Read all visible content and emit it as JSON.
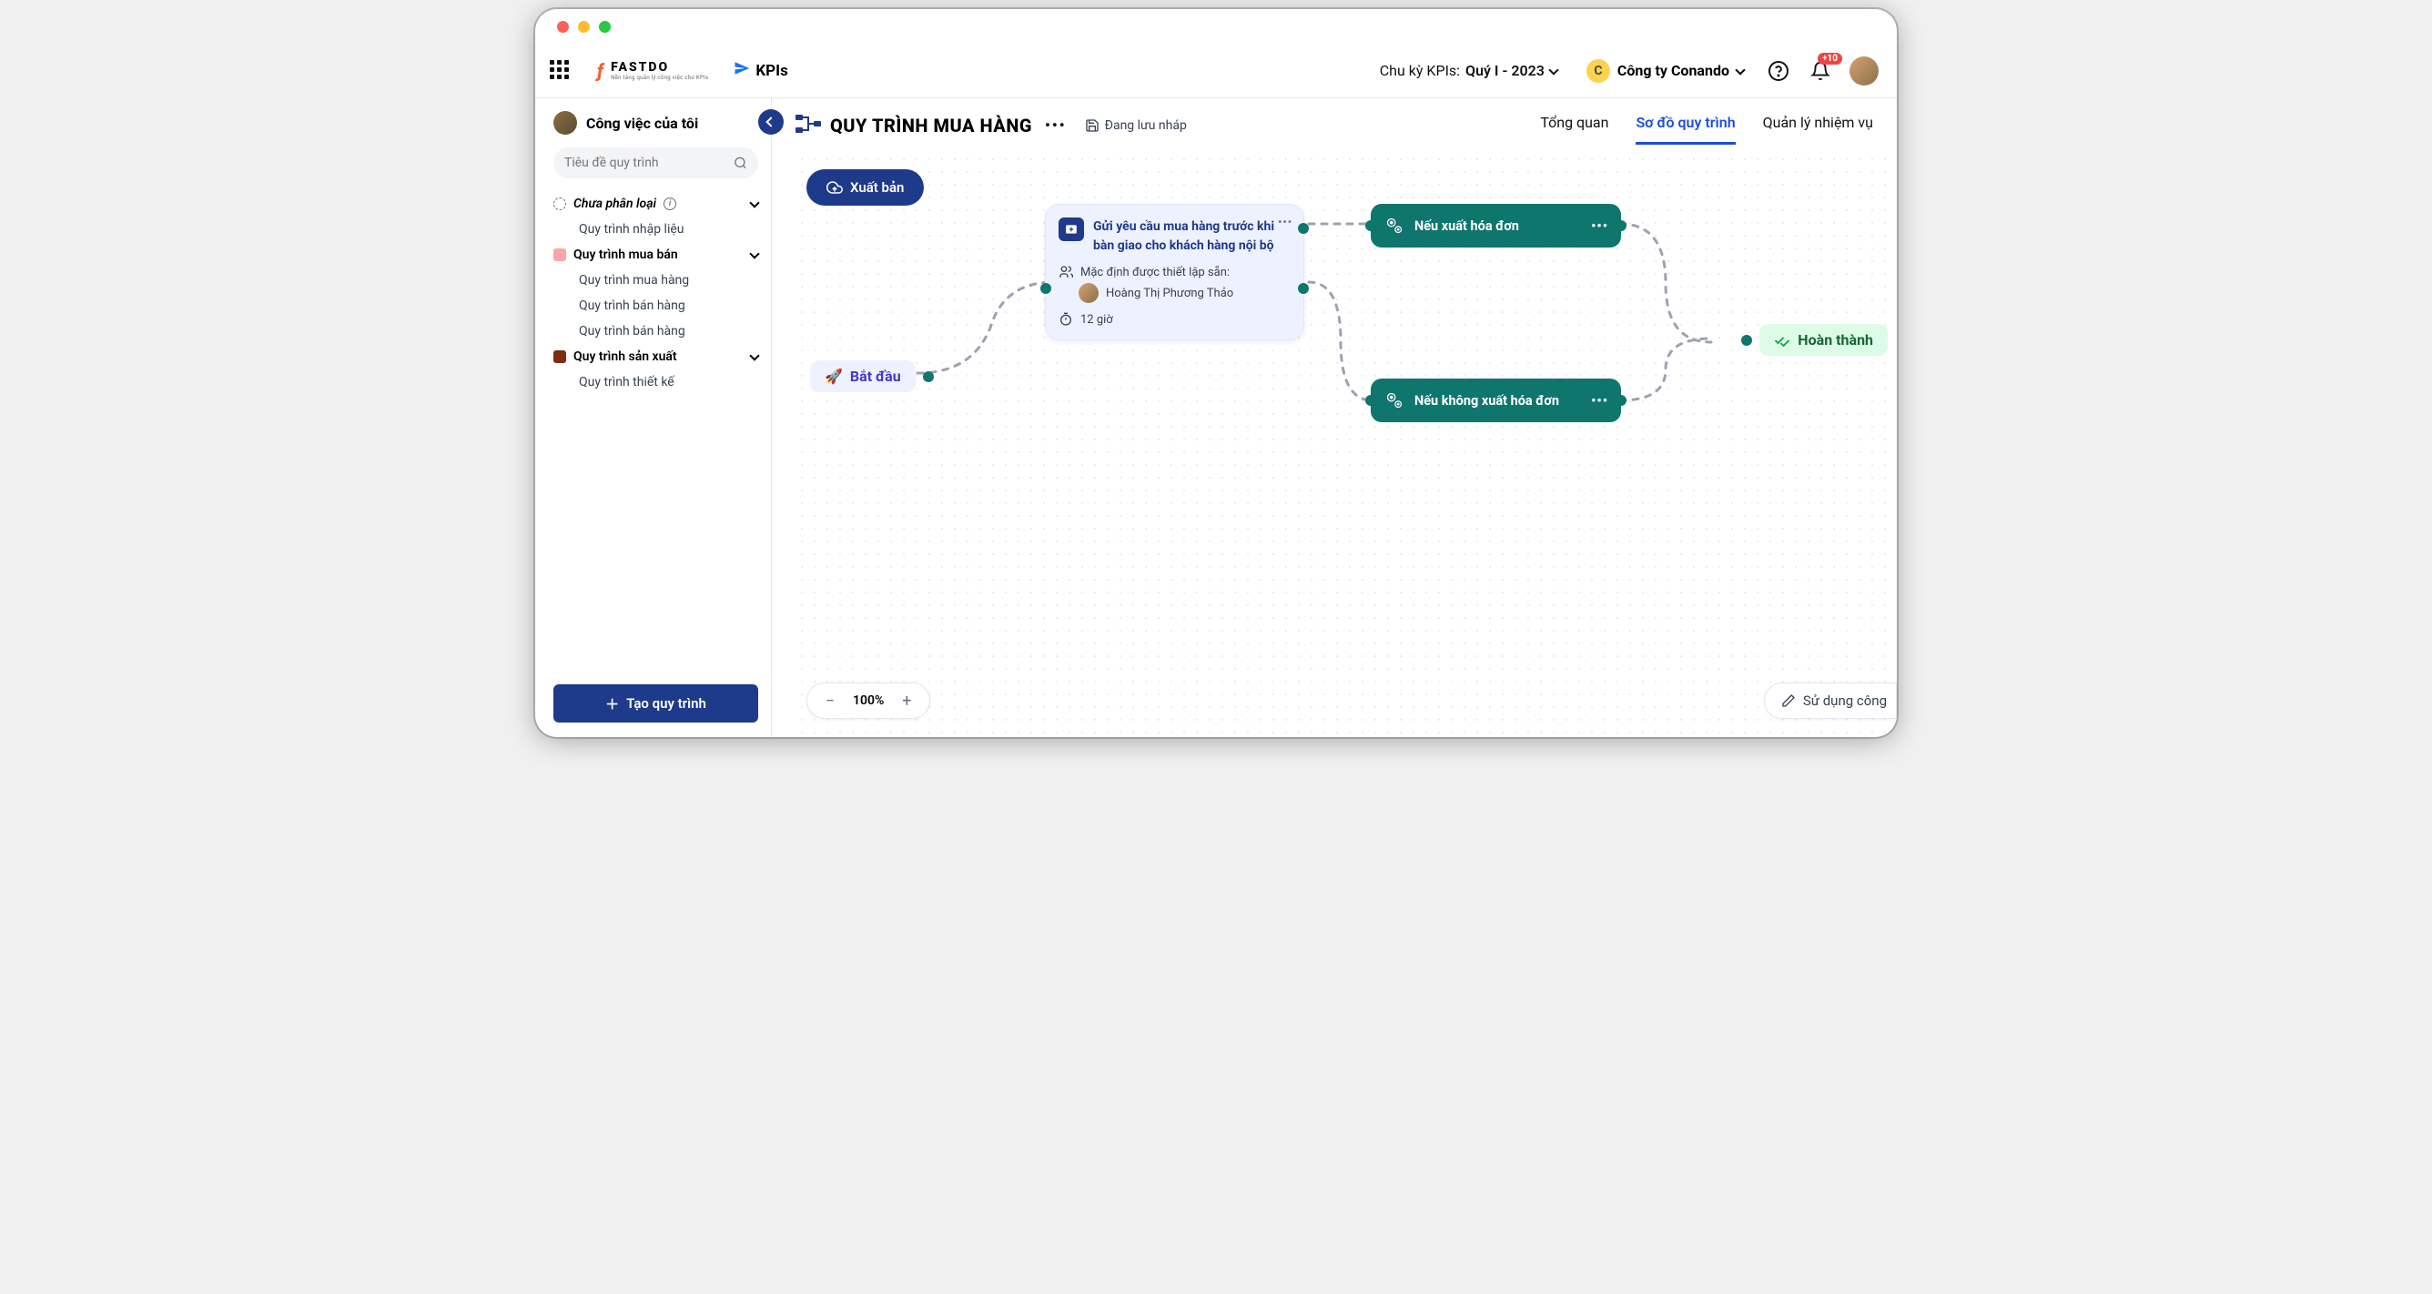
{
  "header": {
    "brand": "FASTDO",
    "brand_sub": "Nền tảng quản lý công việc cho KPIs",
    "kpi_label": "KPIs",
    "cycle_label": "Chu kỳ KPIs:",
    "cycle_value": "Quý I - 2023",
    "company": "Công ty Conando",
    "company_initial": "C",
    "notif_count": "+10"
  },
  "sidebar": {
    "title": "Công việc của tôi",
    "search_placeholder": "Tiêu đề quy trình",
    "groups": [
      {
        "label": "Chưa phân loại",
        "color": "",
        "items": [
          "Quy trình nhập liệu"
        ]
      },
      {
        "label": "Quy trình mua bán",
        "color": "#fca5a5",
        "items": [
          "Quy trình mua hàng",
          "Quy trình bán hàng",
          "Quy trình bán hàng"
        ]
      },
      {
        "label": "Quy trình sản xuất",
        "color": "#7c2d12",
        "items": [
          "Quy trình thiết kế"
        ]
      }
    ],
    "create_button": "Tạo quy trình"
  },
  "main": {
    "title": "QUY TRÌNH MUA HÀNG",
    "draft_status": "Đang lưu nháp",
    "tabs": [
      "Tổng quan",
      "Sơ đồ quy trình",
      "Quản lý nhiệm vụ"
    ],
    "active_tab": 1,
    "publish_button": "Xuất bản",
    "zoom": "100%",
    "use_template": "Sử dụng công"
  },
  "nodes": {
    "start": "Bắt đầu",
    "task": {
      "title": "Gửi yêu cầu mua hàng trước khi bàn giao cho khách hàng nội bộ",
      "assignee_label": "Mặc định được thiết lập sẵn:",
      "assignee": "Hoàng Thị Phương Thảo",
      "duration": "12 giờ"
    },
    "cond1": "Nếu xuất hóa đơn",
    "cond2": "Nếu không xuất hóa đơn",
    "done": "Hoàn thành"
  }
}
